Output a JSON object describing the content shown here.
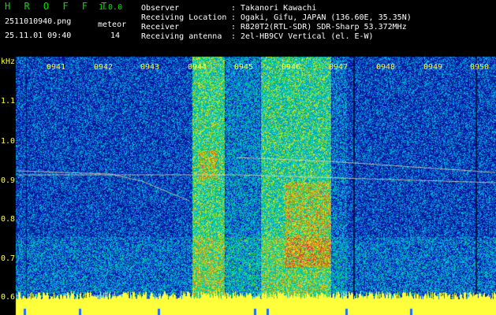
{
  "app": {
    "name": "H R O F F T",
    "version": "1.0.0"
  },
  "file": {
    "name": "2511010940.png",
    "timestamp": "25.11.01 09:40"
  },
  "meteor": {
    "label": "meteor",
    "count": "14"
  },
  "info": [
    {
      "key": "Observer",
      "sep": ":",
      "value": "Takanori Kawachi"
    },
    {
      "key": "Receiving Location",
      "sep": ":",
      "value": "Ogaki, Gifu, JAPAN (136.60E, 35.35N)"
    },
    {
      "key": "Receiver",
      "sep": ":",
      "value": "R820T2(RTL-SDR) SDR-Sharp 53.372MHz"
    },
    {
      "key": "Receiving antenna",
      "sep": ":",
      "value": "2el-HB9CV Vertical (el. E-W)"
    }
  ],
  "axis": {
    "y_unit": "kHz",
    "y_ticks": [
      "1.1",
      "1.0",
      "0.9",
      "0.8",
      "0.7",
      "0.6"
    ],
    "x_ticks": [
      "0941",
      "0942",
      "0943",
      "0944",
      "0945",
      "0946",
      "0947",
      "0948",
      "0949",
      "0950"
    ]
  },
  "colors": {
    "label": "#ffff3c",
    "app": "#00e000",
    "bg": "#000000",
    "noise": "#0a1a8c"
  }
}
